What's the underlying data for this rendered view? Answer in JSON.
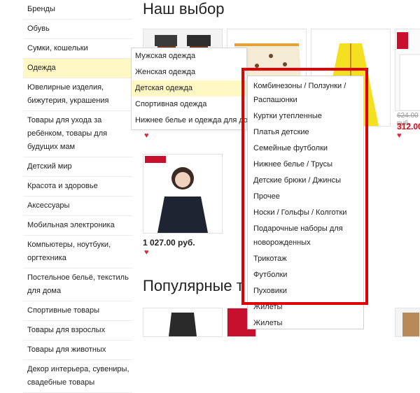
{
  "categories": [
    {
      "label": "Бренды"
    },
    {
      "label": "Обувь"
    },
    {
      "label": "Сумки, кошельки"
    },
    {
      "label": "Одежда",
      "active": true
    },
    {
      "label": "Ювелирные изделия, бижутерия, украшения"
    },
    {
      "label": "Товары для ухода за ребёнком, товары для будущих мам"
    },
    {
      "label": "Детский мир"
    },
    {
      "label": "Красота и здоровье"
    },
    {
      "label": "Аксессуары"
    },
    {
      "label": "Мобильная электроника"
    },
    {
      "label": "Компьютеры, ноутбуки, оргтехника"
    },
    {
      "label": "Постельное бельё, текстиль для дома"
    },
    {
      "label": "Спортивные товары"
    },
    {
      "label": "Товары для взрослых"
    },
    {
      "label": "Товары для животных"
    },
    {
      "label": "Декор интерьера, сувениры, свадебные товары"
    }
  ],
  "submenu": [
    {
      "label": "Мужская одежда"
    },
    {
      "label": "Женская одежда"
    },
    {
      "label": "Детская одежда",
      "active": true
    },
    {
      "label": "Спортивная одежда"
    },
    {
      "label": "Нижнее белье и одежда для дома"
    }
  ],
  "third_menu": [
    {
      "label": "Комбинезоны / Ползунки / Распашонки"
    },
    {
      "label": "Куртки утепленные"
    },
    {
      "label": "Платья детские"
    },
    {
      "label": "Семейные футболки"
    },
    {
      "label": "Нижнее белье / Трусы"
    },
    {
      "label": "Детские брюки / Джинсы"
    },
    {
      "label": "Прочее"
    },
    {
      "label": "Носки / Гольфы / Колготки"
    },
    {
      "label": "Подарочные наборы для новорожденных"
    },
    {
      "label": "Трикотаж"
    },
    {
      "label": "Футболки"
    },
    {
      "label": "Пуховики"
    },
    {
      "label": "Жилеты"
    },
    {
      "label": "Жилеты"
    }
  ],
  "headings": {
    "choice": "Наш выбор",
    "popular": "Популярные т"
  },
  "products": {
    "blouse_price": "1 027.00 руб.",
    "old_price": "624.00 руб.",
    "new_price": "312.00",
    "heart_icon": "♥"
  },
  "colors": {
    "highlight": "#fff8c4",
    "frame": "#e00000",
    "heart": "#d92b3a"
  }
}
